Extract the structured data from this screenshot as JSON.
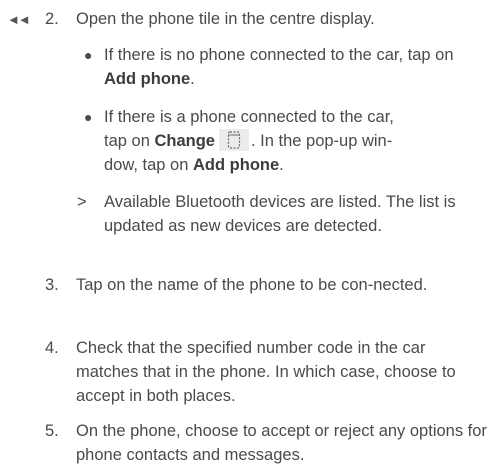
{
  "continued_marker": "◄◄",
  "steps": {
    "s2": {
      "number": "2.",
      "text": "Open the phone tile in the centre display."
    },
    "bullet1": {
      "symbol": "●",
      "prefix": "If there is no phone connected to the car, tap on ",
      "bold": "Add phone",
      "suffix": "."
    },
    "bullet2": {
      "symbol": "●",
      "line1": "If there is a phone connected to the car,",
      "prefix": "tap on ",
      "bold1": "Change",
      "icon": "change-phone-icon",
      "mid": ". In the pop-up win-",
      "line3_prefix": "dow, tap on ",
      "bold2": "Add phone",
      "suffix": "."
    },
    "result": {
      "symbol": ">",
      "text": "Available Bluetooth devices are listed. The list is updated as new devices are detected."
    },
    "s3": {
      "number": "3.",
      "text": "Tap on the name of the phone to be con-nected."
    },
    "s4": {
      "number": "4.",
      "text": "Check that the specified number code in the car matches that in the phone. In which case, choose to accept in both places."
    },
    "s5": {
      "number": "5.",
      "text": "On the phone, choose to accept or reject any options for phone contacts and messages."
    }
  }
}
